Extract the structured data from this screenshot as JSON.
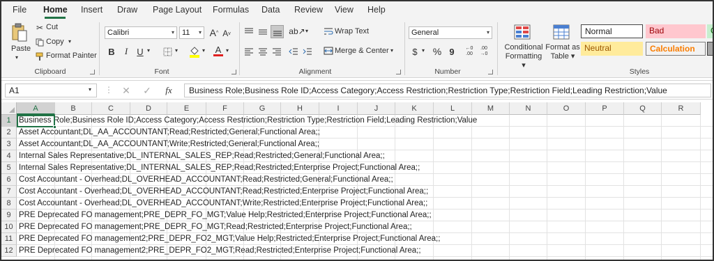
{
  "menu": {
    "tabs": [
      "File",
      "Home",
      "Insert",
      "Draw",
      "Page Layout",
      "Formulas",
      "Data",
      "Review",
      "View",
      "Help"
    ]
  },
  "ribbon": {
    "clipboard": {
      "paste": "Paste",
      "cut": "Cut",
      "copy": "Copy",
      "format_painter": "Format Painter",
      "label": "Clipboard"
    },
    "font": {
      "name": "Calibri",
      "size": "11",
      "bold": "B",
      "italic": "I",
      "underline": "U",
      "grow": "A",
      "shrink": "A",
      "font_color": "A",
      "label": "Font"
    },
    "alignment": {
      "wrap_text": "Wrap Text",
      "merge_center": "Merge & Center",
      "label": "Alignment"
    },
    "number": {
      "format": "General",
      "currency": "$",
      "percent": "%",
      "comma": "9",
      "inc_dec": "←0 .00",
      "dec_dec": ".00 →0",
      "label": "Number"
    },
    "styles": {
      "conditional": "Conditional Formatting",
      "format_as_table": "Format as Table",
      "normal": "Normal",
      "bad": "Bad",
      "good": "G",
      "neutral": "Neutral",
      "calculation": "Calculation",
      "label": "Styles"
    }
  },
  "formula_bar": {
    "name_box": "A1",
    "fx": "fx",
    "content": "Business Role;Business Role ID;Access Category;Access Restriction;Restriction Type;Restriction Field;Leading Restriction;Value"
  },
  "sheet": {
    "columns": [
      "A",
      "B",
      "C",
      "D",
      "E",
      "F",
      "G",
      "H",
      "I",
      "J",
      "K",
      "L",
      "M",
      "N",
      "O",
      "P",
      "Q",
      "R"
    ],
    "rows": [
      {
        "num": "1",
        "text": "Business Role;Business Role ID;Access Category;Access Restriction;Restriction Type;Restriction Field;Leading Restriction;Value"
      },
      {
        "num": "2",
        "text": "Asset Accountant;DL_AA_ACCOUNTANT;Read;Restricted;General;Functional Area;;"
      },
      {
        "num": "3",
        "text": "Asset Accountant;DL_AA_ACCOUNTANT;Write;Restricted;General;Functional Area;;"
      },
      {
        "num": "4",
        "text": "Internal Sales Representative;DL_INTERNAL_SALES_REP;Read;Restricted;General;Functional Area;;"
      },
      {
        "num": "5",
        "text": "Internal Sales Representative;DL_INTERNAL_SALES_REP;Read;Restricted;Enterprise Project;Functional Area;;"
      },
      {
        "num": "6",
        "text": "Cost Accountant - Overhead;DL_OVERHEAD_ACCOUNTANT;Read;Restricted;General;Functional Area;;"
      },
      {
        "num": "7",
        "text": "Cost Accountant - Overhead;DL_OVERHEAD_ACCOUNTANT;Read;Restricted;Enterprise Project;Functional Area;;"
      },
      {
        "num": "8",
        "text": "Cost Accountant - Overhead;DL_OVERHEAD_ACCOUNTANT;Write;Restricted;Enterprise Project;Functional Area;;"
      },
      {
        "num": "9",
        "text": "PRE Deprecated FO management;PRE_DEPR_FO_MGT;Value Help;Restricted;Enterprise Project;Functional Area;;"
      },
      {
        "num": "10",
        "text": "PRE Deprecated FO management;PRE_DEPR_FO_MGT;Read;Restricted;Enterprise Project;Functional Area;;"
      },
      {
        "num": "11",
        "text": "PRE Deprecated FO management2;PRE_DEPR_FO2_MGT;Value Help;Restricted;Enterprise Project;Functional Area;;"
      },
      {
        "num": "12",
        "text": "PRE Deprecated FO management2;PRE_DEPR_FO2_MGT;Read;Restricted;Enterprise Project;Functional Area;;"
      }
    ]
  },
  "colors": {
    "accent": "#217346",
    "bad_bg": "#ffc7ce",
    "bad_fg": "#9c0006",
    "neutral_bg": "#ffeb9c",
    "neutral_fg": "#9c5700",
    "calc_bg": "#f2f2f2",
    "calc_fg": "#fa7d00"
  }
}
